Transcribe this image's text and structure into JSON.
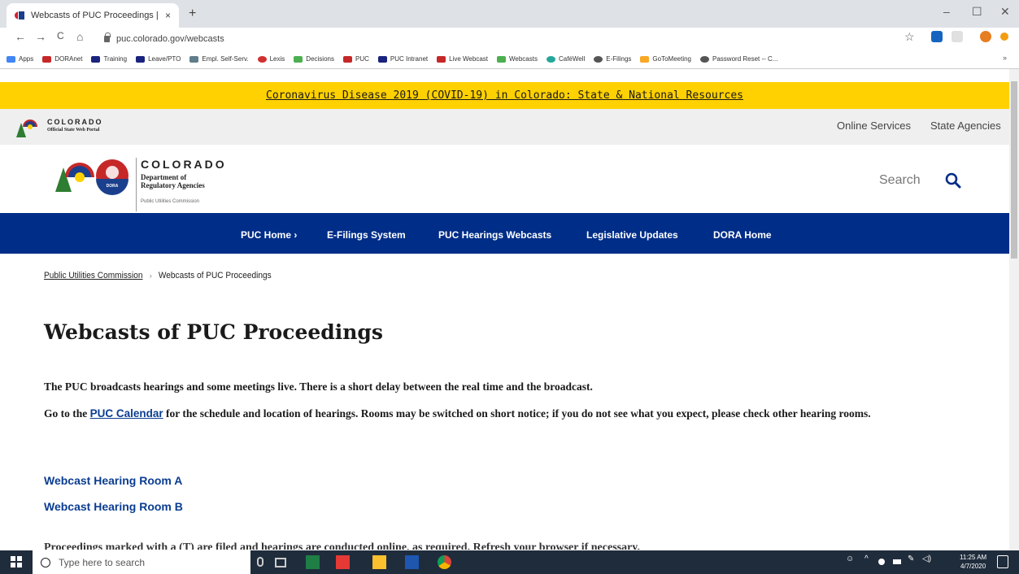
{
  "browser": {
    "tab_title": "Webcasts of PUC Proceedings | ",
    "tab_close": "×",
    "new_tab": "+",
    "window_controls": [
      "–",
      "☐",
      "✕"
    ],
    "nav": {
      "back": "←",
      "forward": "→",
      "reload": "C",
      "home": "⌂"
    },
    "url": "puc.colorado.gov/webcasts",
    "bookmark_star": "☆",
    "more_bookmarks": "»",
    "bookmarks": [
      {
        "label": "Apps",
        "color": "#4285f4"
      },
      {
        "label": "DORAnet",
        "color": "#c62828"
      },
      {
        "label": "Training",
        "color": "#1a237e"
      },
      {
        "label": "Leave/PTO",
        "color": "#1a237e"
      },
      {
        "label": "Empl. Self-Serv.",
        "color": "#607d8b"
      },
      {
        "label": "Lexis",
        "color": "#d32f2f"
      },
      {
        "label": "Decisions",
        "color": "#4caf50"
      },
      {
        "label": "PUC",
        "color": "#c62828"
      },
      {
        "label": "PUC Intranet",
        "color": "#1a237e"
      },
      {
        "label": "Live Webcast",
        "color": "#c62828"
      },
      {
        "label": "Webcasts",
        "color": "#4caf50"
      },
      {
        "label": "CaféWell",
        "color": "#26a69a"
      },
      {
        "label": "E-Filings",
        "color": "#555555"
      },
      {
        "label": "GoToMeeting",
        "color": "#f9a825"
      },
      {
        "label": "Password Reset -- C...",
        "color": "#555555"
      }
    ]
  },
  "banner": {
    "text": "Coronavirus Disease 2019 (COVID-19) in Colorado: State & National Resources"
  },
  "portal": {
    "wordmark": "COLORADO",
    "subtitle": "Official State Web Portal",
    "links": [
      "Online Services",
      "State Agencies"
    ]
  },
  "department": {
    "wordmark": "COLORADO",
    "name_line1": "Department of",
    "name_line2": "Regulatory Agencies",
    "division": "Public Utilities Commission",
    "seal_text": "DORA",
    "search_label": "Search"
  },
  "mainnav": {
    "items": [
      "PUC Home  ›",
      "E-Filings System",
      "PUC Hearings Webcasts",
      "Legislative Updates",
      "DORA Home"
    ]
  },
  "breadcrumb": {
    "parent": "Public Utilities Commission",
    "separator": "›",
    "current": "Webcasts of PUC Proceedings"
  },
  "page": {
    "title": "Webcasts of PUC Proceedings",
    "para1": "The PUC broadcasts hearings and some meetings live. There is a short delay between the real time and the broadcast.",
    "para2_before": "Go to the ",
    "para2_link": "PUC Calendar",
    "para2_after": " for the schedule and location of hearings. Rooms may be switched on short notice; if you do not see what you expect, please check other hearing rooms.",
    "room_a": "Webcast Hearing Room A",
    "room_b": "Webcast Hearing Room B",
    "cutoff_text": "Proceedings marked with a (T) are filed and hearings are conducted online, as required. Refresh your browser if necessary."
  },
  "taskbar": {
    "search_placeholder": "Type here to search",
    "time": "11:25 AM",
    "date": "4/7/2020"
  }
}
